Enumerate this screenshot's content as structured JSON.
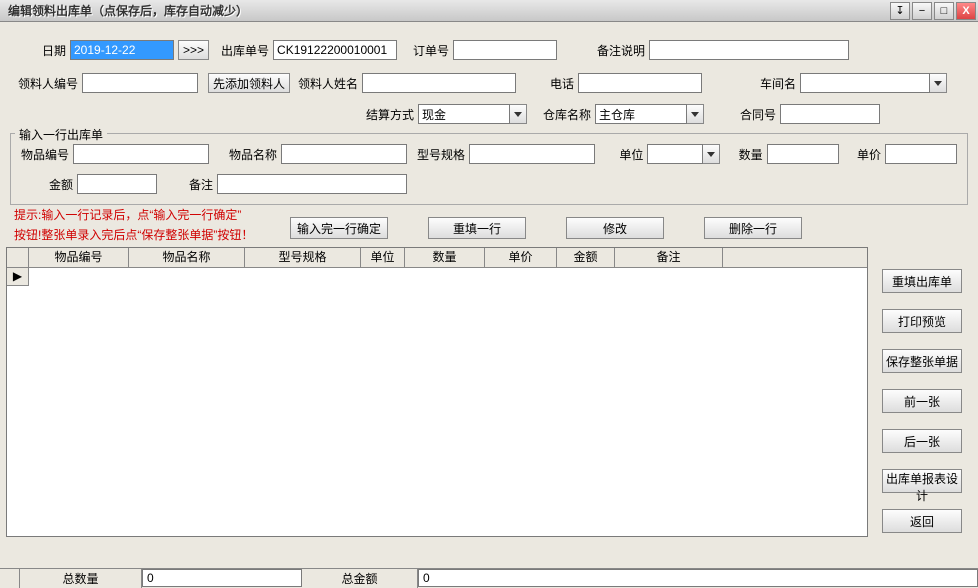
{
  "titlebar": {
    "title": "编辑领料出库单（点保存后，库存自动减少）"
  },
  "icons": {
    "pin": "↧",
    "min": "−",
    "max": "□",
    "close": "X"
  },
  "labels": {
    "date": "日期",
    "docno": "出库单号",
    "order": "订单号",
    "remark_desc": "备注说明",
    "receiver_no": "领料人编号",
    "add_receiver_btn": "先添加领料人",
    "receiver_name": "领料人姓名",
    "phone": "电话",
    "workshop": "车间名",
    "settle": "结算方式",
    "warehouse": "仓库名称",
    "contract": "合同号",
    "fieldset": "输入一行出库单",
    "item_no": "物品编号",
    "item_name": "物品名称",
    "spec": "型号规格",
    "unit": "单位",
    "qty": "数量",
    "price": "单价",
    "amount": "金额",
    "remark": "备注",
    "arrow": ">>>"
  },
  "values": {
    "date": "2019-12-22",
    "docno": "CK19122200010001",
    "order": "",
    "remark_desc": "",
    "receiver_no": "",
    "receiver_name": "",
    "phone": "",
    "workshop": "",
    "settle": "现金",
    "warehouse": "主仓库",
    "contract": "",
    "item_no": "",
    "item_name": "",
    "spec": "",
    "unit": "",
    "qty": "",
    "price": "",
    "amount": "",
    "remark": ""
  },
  "hint": {
    "line1": "提示:输入一行记录后，点“输入完一行确定”",
    "line2": "按钮!整张单录入完后点“保存整张单据”按钮！"
  },
  "row_buttons": {
    "confirm": "输入完一行确定",
    "refill": "重填一行",
    "modify": "修改",
    "delete": "删除一行"
  },
  "grid_headers": [
    "物品编号",
    "物品名称",
    "型号规格",
    "单位",
    "数量",
    "单价",
    "金额",
    "备注"
  ],
  "grid_col_widths": [
    100,
    116,
    116,
    44,
    80,
    72,
    58,
    108
  ],
  "side_buttons": [
    "重填出库单",
    "打印预览",
    "保存整张单据",
    "前一张",
    "后一张",
    "出库单报表设计",
    "返回"
  ],
  "footer": {
    "total_qty_label": "总数量",
    "total_qty": "0",
    "total_amt_label": "总金额",
    "total_amt": "0"
  },
  "row_marker": "▶"
}
